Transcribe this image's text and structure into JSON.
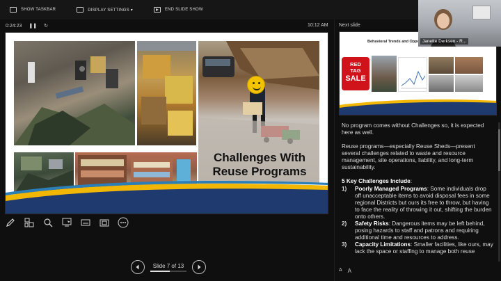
{
  "toolbar": {
    "show_taskbar": "SHOW TASKBAR",
    "display_settings": "DISPLAY SETTINGS ▾",
    "end_slide_show": "END SLIDE SHOW"
  },
  "presenter": {
    "elapsed": "0:24:23",
    "clock": "10:12 AM",
    "next_slide_label": "Next slide"
  },
  "slide": {
    "headline_line1": "Challenges With",
    "headline_line2": "Reuse Programs",
    "counter": "Slide 7 of 13",
    "progress_fraction": 0.538
  },
  "next_slide": {
    "title": "Behavioral Trends and Opportunities",
    "red_tag_line1": "RED",
    "red_tag_line2": "TAG",
    "red_tag_sale": "SALE"
  },
  "webcam": {
    "name": "Janette Derksen - R..."
  },
  "notes": {
    "p1": "No program comes without Challenges so, it is expected here as well.",
    "p2": "Reuse programs—especially Reuse Sheds—present several challenges related to waste and resource management, site operations, liability, and long-term sustainability.",
    "key_heading": "5 Key Challenges Include",
    "key_colon": ":",
    "items": [
      {
        "num": "1)",
        "title": "Poorly Managed Programs",
        "body": ": Some individuals drop off unacceptable items to avoid disposal fees in some regional Districts but ours its free to throw, but having to face the reality of throwing it out, shifting the burden onto others."
      },
      {
        "num": "2)",
        "title": "Safety Risks",
        "body": ": Dangerous items may be left behind, posing hazards to staff and patrons and requiring additional time and resources to address."
      },
      {
        "num": "3)",
        "title": "Capacity Limitations",
        "body": ": Smaller facilities, like ours, may lack the space or staffing to manage both reuse"
      }
    ],
    "font_smaller": "A",
    "font_larger": "A"
  },
  "icons": [
    "pen-icon",
    "all-slides-icon",
    "zoom-icon",
    "pointer-icon",
    "subtitles-icon",
    "camera-icon",
    "more-icon",
    "prev-icon",
    "next-icon"
  ],
  "colors": {
    "navy": "#1f3a6e",
    "gold": "#f2b705",
    "background": "#0f0f0f"
  }
}
